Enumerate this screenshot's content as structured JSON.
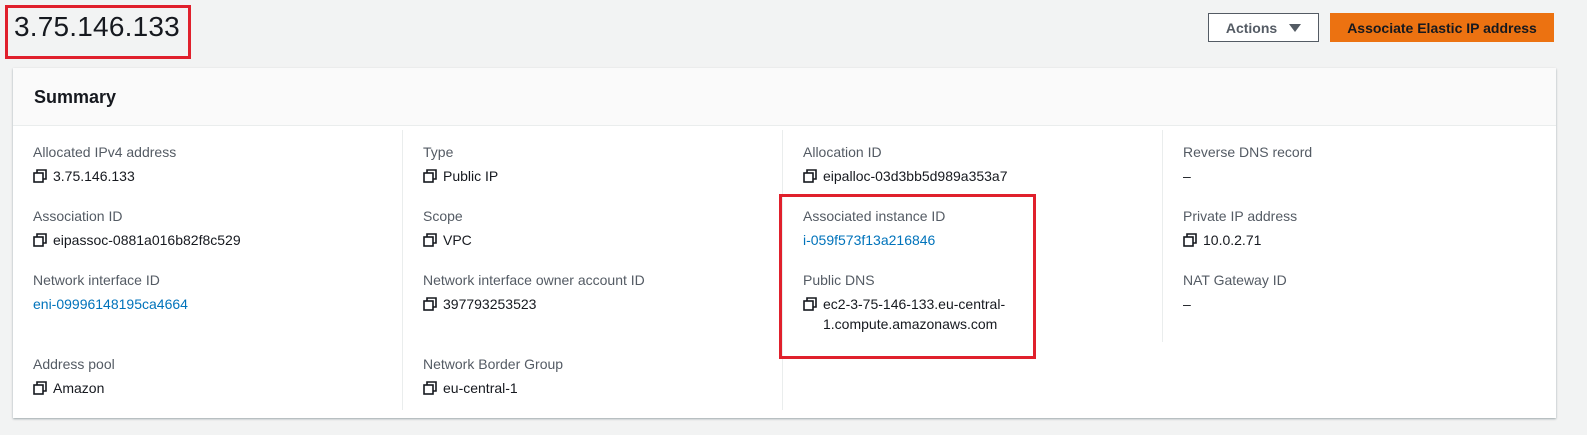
{
  "header": {
    "title": "3.75.146.133",
    "actions_label": "Actions",
    "primary_label": "Associate Elastic IP address"
  },
  "summary": {
    "title": "Summary",
    "fields": {
      "allocated_ipv4": {
        "label": "Allocated IPv4 address",
        "value": "3.75.146.133"
      },
      "type": {
        "label": "Type",
        "value": "Public IP"
      },
      "allocation_id": {
        "label": "Allocation ID",
        "value": "eipalloc-03d3bb5d989a353a7"
      },
      "reverse_dns": {
        "label": "Reverse DNS record",
        "value": "–"
      },
      "association_id": {
        "label": "Association ID",
        "value": "eipassoc-0881a016b82f8c529"
      },
      "scope": {
        "label": "Scope",
        "value": "VPC"
      },
      "associated_instance": {
        "label": "Associated instance ID",
        "value": "i-059f573f13a216846"
      },
      "private_ip": {
        "label": "Private IP address",
        "value": "10.0.2.71"
      },
      "network_interface_id": {
        "label": "Network interface ID",
        "value": "eni-09996148195ca4664"
      },
      "ni_owner": {
        "label": "Network interface owner account ID",
        "value": "397793253523"
      },
      "public_dns": {
        "label": "Public DNS",
        "value": "ec2-3-75-146-133.eu-central-1.compute.amazonaws.com"
      },
      "nat_gateway": {
        "label": "NAT Gateway ID",
        "value": "–"
      },
      "address_pool": {
        "label": "Address pool",
        "value": "Amazon"
      },
      "border_group": {
        "label": "Network Border Group",
        "value": "eu-central-1"
      }
    }
  },
  "colors": {
    "link": "#0073bb",
    "primary_button": "#ec7211",
    "highlight": "#e0202c"
  },
  "icons": {
    "copy": "copy-icon",
    "dropdown": "caret-down-icon"
  }
}
